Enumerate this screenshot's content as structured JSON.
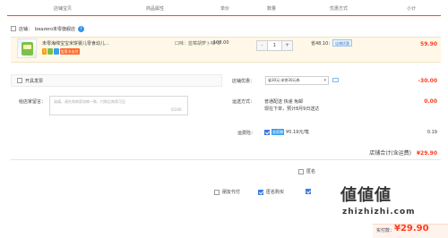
{
  "header": {
    "columns": [
      "店铺宝贝",
      "商品属性",
      "单价",
      "数量",
      "优惠方式",
      "小计"
    ]
  },
  "shop": {
    "prefix": "店铺：",
    "name": "beazero未零旗舰店",
    "info_icon": "info-icon"
  },
  "item": {
    "title": "未零海绵宝宝米饼婴儿零食幼儿...",
    "tags": [
      {
        "text": "7",
        "color": "#f2a000"
      },
      {
        "text": "",
        "color": "#7cc04b"
      },
      {
        "text": "",
        "color": "#3ca0f0"
      },
      {
        "text": "信用卡支付",
        "color": "#ff6b2b"
      }
    ],
    "attr": "口味：蓝莓胡萝卜味*3",
    "price": "108.00",
    "qty": {
      "minus": "-",
      "value": "1",
      "plus": "+"
    },
    "promo_text": "省48.10:",
    "promo_badge": "店铺优惠",
    "subtotal": "59.90"
  },
  "gift": {
    "label": "开具发票"
  },
  "message": {
    "label": "给店家留言：",
    "placeholder": "选填，请先和商家协商一致，付款后商家可见",
    "count": "0/200"
  },
  "coupon": {
    "label": "店铺优惠：",
    "value": "省30元:米饼30元券",
    "amount": "-30.00"
  },
  "shipping": {
    "label": "运送方式：",
    "line1": "普通配送 快递 免邮",
    "line2": "现在下单，预计8月9日送达",
    "amount": "0.00"
  },
  "insurance": {
    "label": "运费险：",
    "tag": "卖家赠",
    "text": "¥0.19元/笔",
    "amount": "0.19"
  },
  "subtotal": {
    "label": "店铺合计(含运费)",
    "amount": "¥29.90"
  },
  "footer": {
    "anonymous": "匿名购买",
    "friend_pay": "朋友代付",
    "gift_opt": "匿名",
    "final_label": "实付款：",
    "final_amount": "¥29.90"
  },
  "watermark": {
    "title": "值值值",
    "url": "zhizhizhi.com"
  },
  "colors": {
    "accent": "#ff4a00",
    "price_red": "#ff3b1f",
    "check_blue": "#3d7be0"
  }
}
